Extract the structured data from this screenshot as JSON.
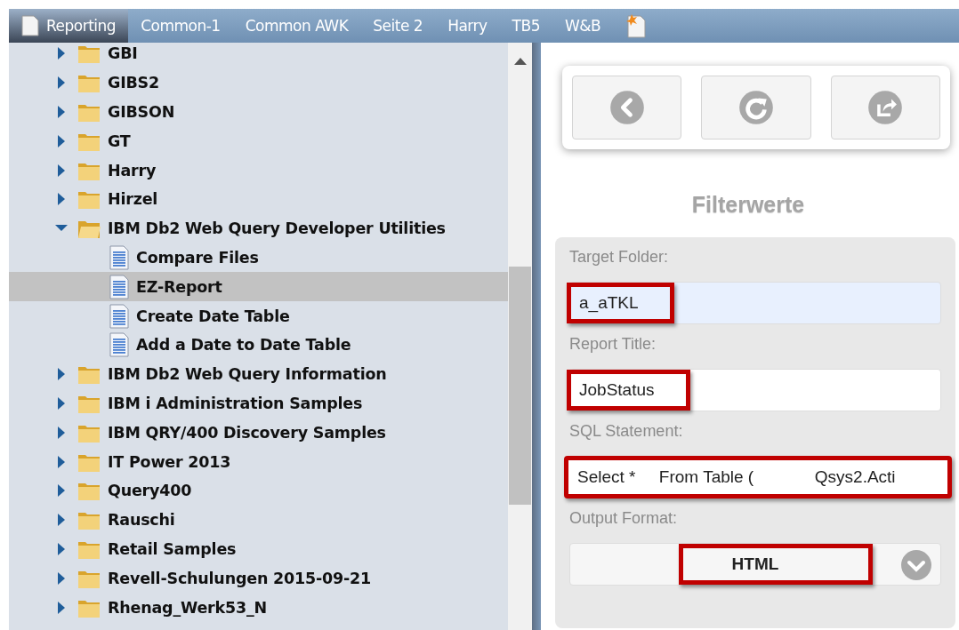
{
  "tabs": [
    {
      "label": "Reporting",
      "selected": true,
      "kind": "document"
    },
    {
      "label": "Common-1",
      "selected": false,
      "kind": "text"
    },
    {
      "label": "Common AWK",
      "selected": false,
      "kind": "text"
    },
    {
      "label": "Seite 2",
      "selected": false,
      "kind": "text"
    },
    {
      "label": "Harry",
      "selected": false,
      "kind": "text"
    },
    {
      "label": "TB5",
      "selected": false,
      "kind": "text"
    },
    {
      "label": "W&B",
      "selected": false,
      "kind": "text"
    },
    {
      "kind": "new"
    }
  ],
  "tree": [
    {
      "label": "GBI",
      "kind": "folder",
      "expanded": false,
      "selected": false
    },
    {
      "label": "GIBS2",
      "kind": "folder",
      "expanded": false,
      "selected": false
    },
    {
      "label": "GIBSON",
      "kind": "folder",
      "expanded": false,
      "selected": false
    },
    {
      "label": "GT",
      "kind": "folder",
      "expanded": false,
      "selected": false
    },
    {
      "label": "Harry",
      "kind": "folder",
      "expanded": false,
      "selected": false
    },
    {
      "label": "Hirzel",
      "kind": "folder",
      "expanded": false,
      "selected": false
    },
    {
      "label": "IBM Db2 Web Query Developer Utilities",
      "kind": "folder",
      "expanded": true,
      "selected": false,
      "children": [
        {
          "label": "Compare Files",
          "kind": "report",
          "selected": false
        },
        {
          "label": "EZ-Report",
          "kind": "report",
          "selected": true
        },
        {
          "label": "Create Date Table",
          "kind": "report",
          "selected": false
        },
        {
          "label": "Add a Date to Date Table",
          "kind": "report",
          "selected": false
        }
      ]
    },
    {
      "label": "IBM Db2 Web Query Information",
      "kind": "folder",
      "expanded": false,
      "selected": false
    },
    {
      "label": "IBM i Administration Samples",
      "kind": "folder",
      "expanded": false,
      "selected": false
    },
    {
      "label": "IBM QRY/400 Discovery Samples",
      "kind": "folder",
      "expanded": false,
      "selected": false
    },
    {
      "label": "IT Power 2013",
      "kind": "folder",
      "expanded": false,
      "selected": false
    },
    {
      "label": "Query400",
      "kind": "folder",
      "expanded": false,
      "selected": false
    },
    {
      "label": "Rauschi",
      "kind": "folder",
      "expanded": false,
      "selected": false
    },
    {
      "label": "Retail Samples",
      "kind": "folder",
      "expanded": false,
      "selected": false
    },
    {
      "label": "Revell-Schulungen 2015-09-21",
      "kind": "folder",
      "expanded": false,
      "selected": false
    },
    {
      "label": "Rhenag_Werk53_N",
      "kind": "folder",
      "expanded": false,
      "selected": false
    }
  ],
  "toolbar": [
    {
      "kind": "back"
    },
    {
      "kind": "refresh"
    },
    {
      "kind": "share"
    }
  ],
  "form": {
    "title": "Filterwerte",
    "fields": [
      {
        "label": "Target Folder:",
        "kind": "text",
        "value": "a_aTKL",
        "autofilled": true,
        "highlighted": true,
        "frame_whole": false
      },
      {
        "label": "Report Title:",
        "kind": "text",
        "value": "JobStatus",
        "autofilled": false,
        "highlighted": true,
        "frame_whole": false
      },
      {
        "label": "SQL Statement:",
        "kind": "text",
        "value": "Select *     From Table (             Qsys2.Acti",
        "autofilled": false,
        "highlighted": true,
        "frame_whole": true
      },
      {
        "label": "Output Format:",
        "kind": "select",
        "value": "HTML",
        "autofilled": false,
        "highlighted": true,
        "frame_whole": false
      }
    ]
  }
}
